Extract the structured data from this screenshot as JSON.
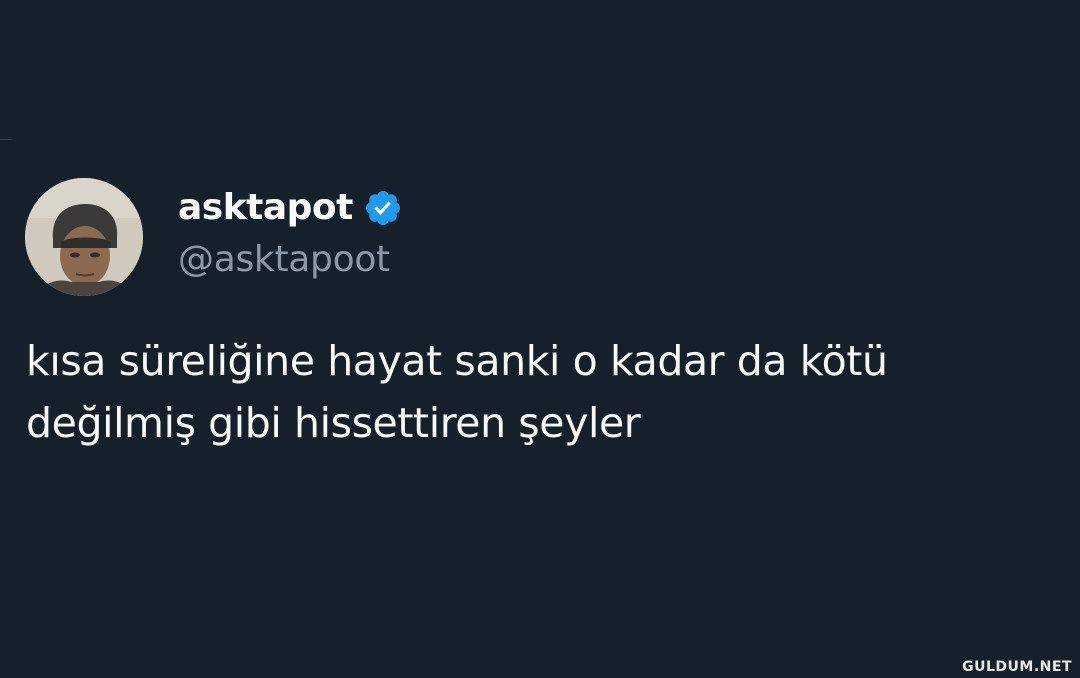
{
  "tweet": {
    "display_name": "asktapot",
    "handle": "@asktapoot",
    "verified": true,
    "text_lines": [
      "kısa süreliğine hayat sanki o kadar da kötü",
      "değilmiş gibi hissettiren şeyler"
    ]
  },
  "watermark": "GULDUM.NET",
  "icons": {
    "verified": "verified-badge-icon",
    "avatar": "profile-photo"
  },
  "colors": {
    "background": "#15202b",
    "primary_text": "#f7f9f9",
    "secondary_text": "#8b98a5",
    "verified_blue": "#1d9bf0"
  }
}
